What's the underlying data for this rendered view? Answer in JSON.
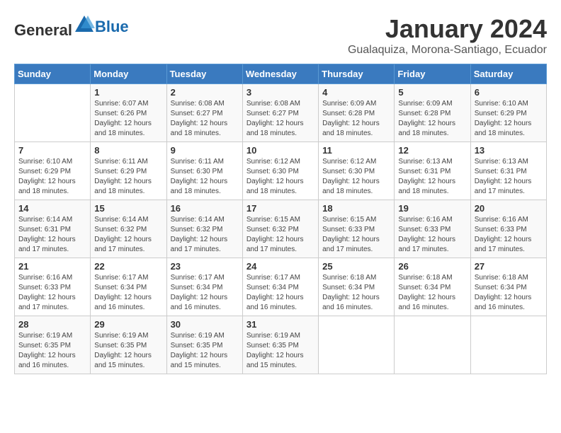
{
  "header": {
    "logo_general": "General",
    "logo_blue": "Blue",
    "month": "January 2024",
    "location": "Gualaquiza, Morona-Santiago, Ecuador"
  },
  "weekdays": [
    "Sunday",
    "Monday",
    "Tuesday",
    "Wednesday",
    "Thursday",
    "Friday",
    "Saturday"
  ],
  "weeks": [
    [
      {
        "day": "",
        "info": ""
      },
      {
        "day": "1",
        "info": "Sunrise: 6:07 AM\nSunset: 6:26 PM\nDaylight: 12 hours\nand 18 minutes."
      },
      {
        "day": "2",
        "info": "Sunrise: 6:08 AM\nSunset: 6:27 PM\nDaylight: 12 hours\nand 18 minutes."
      },
      {
        "day": "3",
        "info": "Sunrise: 6:08 AM\nSunset: 6:27 PM\nDaylight: 12 hours\nand 18 minutes."
      },
      {
        "day": "4",
        "info": "Sunrise: 6:09 AM\nSunset: 6:28 PM\nDaylight: 12 hours\nand 18 minutes."
      },
      {
        "day": "5",
        "info": "Sunrise: 6:09 AM\nSunset: 6:28 PM\nDaylight: 12 hours\nand 18 minutes."
      },
      {
        "day": "6",
        "info": "Sunrise: 6:10 AM\nSunset: 6:29 PM\nDaylight: 12 hours\nand 18 minutes."
      }
    ],
    [
      {
        "day": "7",
        "info": "Sunrise: 6:10 AM\nSunset: 6:29 PM\nDaylight: 12 hours\nand 18 minutes."
      },
      {
        "day": "8",
        "info": "Sunrise: 6:11 AM\nSunset: 6:29 PM\nDaylight: 12 hours\nand 18 minutes."
      },
      {
        "day": "9",
        "info": "Sunrise: 6:11 AM\nSunset: 6:30 PM\nDaylight: 12 hours\nand 18 minutes."
      },
      {
        "day": "10",
        "info": "Sunrise: 6:12 AM\nSunset: 6:30 PM\nDaylight: 12 hours\nand 18 minutes."
      },
      {
        "day": "11",
        "info": "Sunrise: 6:12 AM\nSunset: 6:30 PM\nDaylight: 12 hours\nand 18 minutes."
      },
      {
        "day": "12",
        "info": "Sunrise: 6:13 AM\nSunset: 6:31 PM\nDaylight: 12 hours\nand 18 minutes."
      },
      {
        "day": "13",
        "info": "Sunrise: 6:13 AM\nSunset: 6:31 PM\nDaylight: 12 hours\nand 17 minutes."
      }
    ],
    [
      {
        "day": "14",
        "info": "Sunrise: 6:14 AM\nSunset: 6:31 PM\nDaylight: 12 hours\nand 17 minutes."
      },
      {
        "day": "15",
        "info": "Sunrise: 6:14 AM\nSunset: 6:32 PM\nDaylight: 12 hours\nand 17 minutes."
      },
      {
        "day": "16",
        "info": "Sunrise: 6:14 AM\nSunset: 6:32 PM\nDaylight: 12 hours\nand 17 minutes."
      },
      {
        "day": "17",
        "info": "Sunrise: 6:15 AM\nSunset: 6:32 PM\nDaylight: 12 hours\nand 17 minutes."
      },
      {
        "day": "18",
        "info": "Sunrise: 6:15 AM\nSunset: 6:33 PM\nDaylight: 12 hours\nand 17 minutes."
      },
      {
        "day": "19",
        "info": "Sunrise: 6:16 AM\nSunset: 6:33 PM\nDaylight: 12 hours\nand 17 minutes."
      },
      {
        "day": "20",
        "info": "Sunrise: 6:16 AM\nSunset: 6:33 PM\nDaylight: 12 hours\nand 17 minutes."
      }
    ],
    [
      {
        "day": "21",
        "info": "Sunrise: 6:16 AM\nSunset: 6:33 PM\nDaylight: 12 hours\nand 17 minutes."
      },
      {
        "day": "22",
        "info": "Sunrise: 6:17 AM\nSunset: 6:34 PM\nDaylight: 12 hours\nand 16 minutes."
      },
      {
        "day": "23",
        "info": "Sunrise: 6:17 AM\nSunset: 6:34 PM\nDaylight: 12 hours\nand 16 minutes."
      },
      {
        "day": "24",
        "info": "Sunrise: 6:17 AM\nSunset: 6:34 PM\nDaylight: 12 hours\nand 16 minutes."
      },
      {
        "day": "25",
        "info": "Sunrise: 6:18 AM\nSunset: 6:34 PM\nDaylight: 12 hours\nand 16 minutes."
      },
      {
        "day": "26",
        "info": "Sunrise: 6:18 AM\nSunset: 6:34 PM\nDaylight: 12 hours\nand 16 minutes."
      },
      {
        "day": "27",
        "info": "Sunrise: 6:18 AM\nSunset: 6:34 PM\nDaylight: 12 hours\nand 16 minutes."
      }
    ],
    [
      {
        "day": "28",
        "info": "Sunrise: 6:19 AM\nSunset: 6:35 PM\nDaylight: 12 hours\nand 16 minutes."
      },
      {
        "day": "29",
        "info": "Sunrise: 6:19 AM\nSunset: 6:35 PM\nDaylight: 12 hours\nand 15 minutes."
      },
      {
        "day": "30",
        "info": "Sunrise: 6:19 AM\nSunset: 6:35 PM\nDaylight: 12 hours\nand 15 minutes."
      },
      {
        "day": "31",
        "info": "Sunrise: 6:19 AM\nSunset: 6:35 PM\nDaylight: 12 hours\nand 15 minutes."
      },
      {
        "day": "",
        "info": ""
      },
      {
        "day": "",
        "info": ""
      },
      {
        "day": "",
        "info": ""
      }
    ]
  ]
}
